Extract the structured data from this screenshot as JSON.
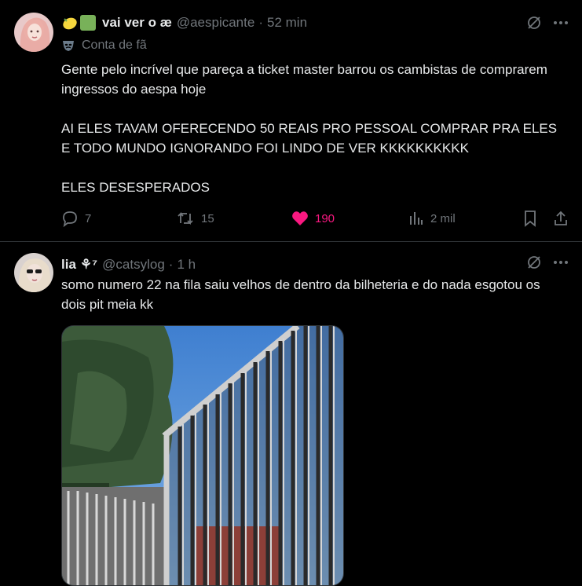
{
  "tweets": [
    {
      "name": "vai ver o æ",
      "name_emojis": [
        "lemon",
        "green-square"
      ],
      "handle": "@aespicante",
      "sep": "·",
      "time": "52 min",
      "label": "Conta de fã",
      "text": "Gente pelo incrível que pareça a ticket master barrou os cambistas de comprarem ingressos do aespa hoje\n\nAI ELES TAVAM OFERECENDO 50 REAIS PRO PESSOAL COMPRAR PRA ELES E TODO MUNDO IGNORANDO FOI LINDO DE VER KKKKKKKKKK\n\nELES DESESPERADOS",
      "replies": "7",
      "reposts": "15",
      "likes": "190",
      "views": "2 mil"
    },
    {
      "name": "lia",
      "name_suffix": "⚘⁷",
      "handle": "@catsylog",
      "sep": "·",
      "time": "1 h",
      "text": "somo numero 22 na fila saiu velhos de dentro da bilheteria e do nada esgotou os dois pit meia kk"
    }
  ],
  "colors": {
    "background": "#000000",
    "text": "#e7e9ea",
    "muted": "#71767b",
    "like": "#f91880",
    "divider": "#2f3336"
  }
}
